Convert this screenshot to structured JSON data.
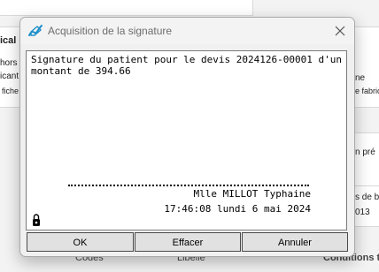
{
  "background": {
    "left_labels": [
      "ical",
      "hors",
      "icant",
      "fiche"
    ],
    "right_labels": [
      "ne",
      "e fabric"
    ],
    "right_mid_labels": [
      "n pré",
      "s de b",
      "013"
    ],
    "footer_labels": [
      "Codes",
      "Libellé",
      "Conditions t"
    ]
  },
  "dialog": {
    "title": "Acquisition de la signature",
    "message": "Signature du patient pour le devis 2024126-00001 d'un montant de 394.66",
    "signer_name": "Mlle MILLOT Typhaine",
    "timestamp": "17:46:08 lundi 6 mai 2024",
    "buttons": {
      "ok": "OK",
      "clear": "Effacer",
      "cancel": "Annuler"
    }
  },
  "icons": {
    "title": "signature-pen-icon",
    "close": "close-icon",
    "lock": "padlock-icon"
  },
  "colors": {
    "title_text": "#6d6d6d",
    "button_bg": "#e1e1e1",
    "dialog_bg": "#f0f0f0"
  }
}
